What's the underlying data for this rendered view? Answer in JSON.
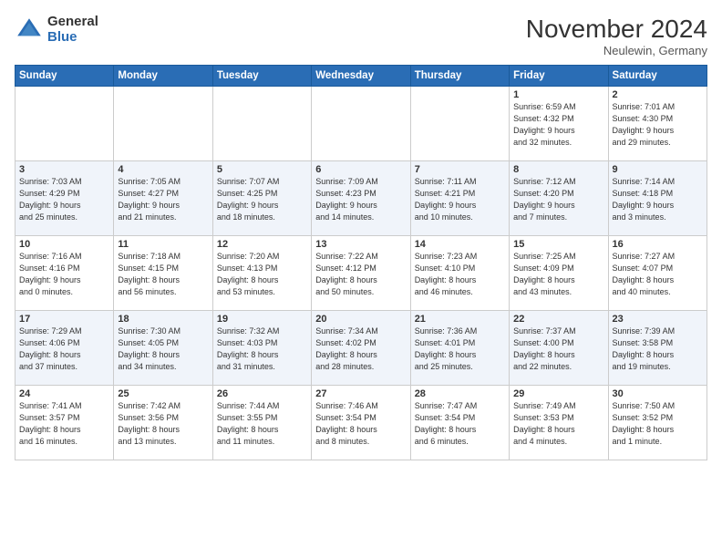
{
  "logo": {
    "general": "General",
    "blue": "Blue"
  },
  "header": {
    "month": "November 2024",
    "location": "Neulewin, Germany"
  },
  "days_of_week": [
    "Sunday",
    "Monday",
    "Tuesday",
    "Wednesday",
    "Thursday",
    "Friday",
    "Saturday"
  ],
  "weeks": [
    [
      {
        "day": "",
        "info": ""
      },
      {
        "day": "",
        "info": ""
      },
      {
        "day": "",
        "info": ""
      },
      {
        "day": "",
        "info": ""
      },
      {
        "day": "",
        "info": ""
      },
      {
        "day": "1",
        "info": "Sunrise: 6:59 AM\nSunset: 4:32 PM\nDaylight: 9 hours\nand 32 minutes."
      },
      {
        "day": "2",
        "info": "Sunrise: 7:01 AM\nSunset: 4:30 PM\nDaylight: 9 hours\nand 29 minutes."
      }
    ],
    [
      {
        "day": "3",
        "info": "Sunrise: 7:03 AM\nSunset: 4:29 PM\nDaylight: 9 hours\nand 25 minutes."
      },
      {
        "day": "4",
        "info": "Sunrise: 7:05 AM\nSunset: 4:27 PM\nDaylight: 9 hours\nand 21 minutes."
      },
      {
        "day": "5",
        "info": "Sunrise: 7:07 AM\nSunset: 4:25 PM\nDaylight: 9 hours\nand 18 minutes."
      },
      {
        "day": "6",
        "info": "Sunrise: 7:09 AM\nSunset: 4:23 PM\nDaylight: 9 hours\nand 14 minutes."
      },
      {
        "day": "7",
        "info": "Sunrise: 7:11 AM\nSunset: 4:21 PM\nDaylight: 9 hours\nand 10 minutes."
      },
      {
        "day": "8",
        "info": "Sunrise: 7:12 AM\nSunset: 4:20 PM\nDaylight: 9 hours\nand 7 minutes."
      },
      {
        "day": "9",
        "info": "Sunrise: 7:14 AM\nSunset: 4:18 PM\nDaylight: 9 hours\nand 3 minutes."
      }
    ],
    [
      {
        "day": "10",
        "info": "Sunrise: 7:16 AM\nSunset: 4:16 PM\nDaylight: 9 hours\nand 0 minutes."
      },
      {
        "day": "11",
        "info": "Sunrise: 7:18 AM\nSunset: 4:15 PM\nDaylight: 8 hours\nand 56 minutes."
      },
      {
        "day": "12",
        "info": "Sunrise: 7:20 AM\nSunset: 4:13 PM\nDaylight: 8 hours\nand 53 minutes."
      },
      {
        "day": "13",
        "info": "Sunrise: 7:22 AM\nSunset: 4:12 PM\nDaylight: 8 hours\nand 50 minutes."
      },
      {
        "day": "14",
        "info": "Sunrise: 7:23 AM\nSunset: 4:10 PM\nDaylight: 8 hours\nand 46 minutes."
      },
      {
        "day": "15",
        "info": "Sunrise: 7:25 AM\nSunset: 4:09 PM\nDaylight: 8 hours\nand 43 minutes."
      },
      {
        "day": "16",
        "info": "Sunrise: 7:27 AM\nSunset: 4:07 PM\nDaylight: 8 hours\nand 40 minutes."
      }
    ],
    [
      {
        "day": "17",
        "info": "Sunrise: 7:29 AM\nSunset: 4:06 PM\nDaylight: 8 hours\nand 37 minutes."
      },
      {
        "day": "18",
        "info": "Sunrise: 7:30 AM\nSunset: 4:05 PM\nDaylight: 8 hours\nand 34 minutes."
      },
      {
        "day": "19",
        "info": "Sunrise: 7:32 AM\nSunset: 4:03 PM\nDaylight: 8 hours\nand 31 minutes."
      },
      {
        "day": "20",
        "info": "Sunrise: 7:34 AM\nSunset: 4:02 PM\nDaylight: 8 hours\nand 28 minutes."
      },
      {
        "day": "21",
        "info": "Sunrise: 7:36 AM\nSunset: 4:01 PM\nDaylight: 8 hours\nand 25 minutes."
      },
      {
        "day": "22",
        "info": "Sunrise: 7:37 AM\nSunset: 4:00 PM\nDaylight: 8 hours\nand 22 minutes."
      },
      {
        "day": "23",
        "info": "Sunrise: 7:39 AM\nSunset: 3:58 PM\nDaylight: 8 hours\nand 19 minutes."
      }
    ],
    [
      {
        "day": "24",
        "info": "Sunrise: 7:41 AM\nSunset: 3:57 PM\nDaylight: 8 hours\nand 16 minutes."
      },
      {
        "day": "25",
        "info": "Sunrise: 7:42 AM\nSunset: 3:56 PM\nDaylight: 8 hours\nand 13 minutes."
      },
      {
        "day": "26",
        "info": "Sunrise: 7:44 AM\nSunset: 3:55 PM\nDaylight: 8 hours\nand 11 minutes."
      },
      {
        "day": "27",
        "info": "Sunrise: 7:46 AM\nSunset: 3:54 PM\nDaylight: 8 hours\nand 8 minutes."
      },
      {
        "day": "28",
        "info": "Sunrise: 7:47 AM\nSunset: 3:54 PM\nDaylight: 8 hours\nand 6 minutes."
      },
      {
        "day": "29",
        "info": "Sunrise: 7:49 AM\nSunset: 3:53 PM\nDaylight: 8 hours\nand 4 minutes."
      },
      {
        "day": "30",
        "info": "Sunrise: 7:50 AM\nSunset: 3:52 PM\nDaylight: 8 hours\nand 1 minute."
      }
    ]
  ]
}
